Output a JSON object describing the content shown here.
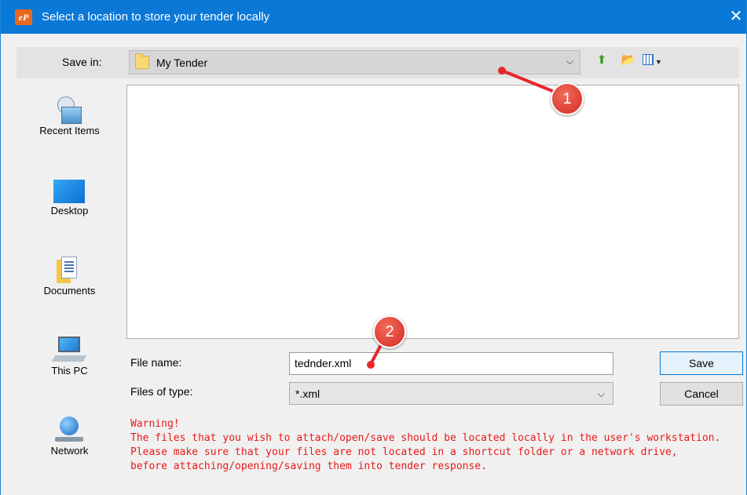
{
  "window": {
    "title": "Select a location to store your tender locally",
    "logo_text": "eP",
    "close_glyph": "✕"
  },
  "toolbar": {
    "save_in_label": "Save in:",
    "current_folder": "My Tender",
    "icons": [
      "up-one-level-icon",
      "create-new-folder-icon",
      "view-menu-icon"
    ]
  },
  "places": [
    {
      "label": "Recent Items",
      "icon": "recent-items-icon"
    },
    {
      "label": "Desktop",
      "icon": "desktop-icon"
    },
    {
      "label": "Documents",
      "icon": "documents-icon"
    },
    {
      "label": "This PC",
      "icon": "this-pc-icon"
    },
    {
      "label": "Network",
      "icon": "network-icon"
    }
  ],
  "form": {
    "file_name_label": "File name:",
    "file_name_value": "tednder.xml",
    "file_type_label": "Files of type:",
    "file_type_value": "*.xml"
  },
  "buttons": {
    "save": "Save",
    "cancel": "Cancel"
  },
  "warning": {
    "title": "Warning!",
    "lines": [
      "The files that you wish to attach/open/save should be located locally in the user's workstation.",
      "Please make sure that your files are not located in a shortcut folder or a network drive,",
      "before attaching/opening/saving them into tender response."
    ]
  },
  "callouts": [
    {
      "number": "1"
    },
    {
      "number": "2"
    }
  ],
  "colors": {
    "titlebar": "#0a78d7",
    "warning_text": "#e81a1a",
    "callout": "#e8262a"
  }
}
